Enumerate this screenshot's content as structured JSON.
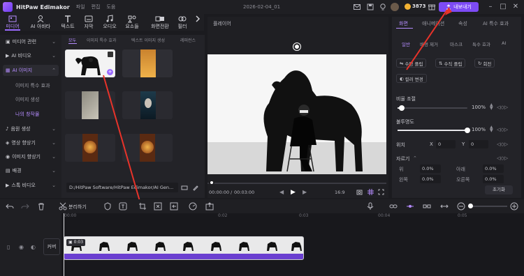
{
  "titlebar": {
    "app_name": "HitPaw Edimakor",
    "menu": [
      "파일",
      "편집",
      "도움"
    ],
    "doc_title": "2026-02-04_01",
    "credits": "3873",
    "export_label": "내보내기"
  },
  "tool_tabs": [
    {
      "label": "미디어",
      "icon": "media-icon"
    },
    {
      "label": "AI 아바타",
      "icon": "avatar-icon"
    },
    {
      "label": "텍스트",
      "icon": "text-icon"
    },
    {
      "label": "자막",
      "icon": "subtitle-icon"
    },
    {
      "label": "오디오",
      "icon": "audio-icon"
    },
    {
      "label": "요소들",
      "icon": "elements-icon"
    },
    {
      "label": "화면전환",
      "icon": "transition-icon"
    },
    {
      "label": "필터",
      "icon": "filter-icon"
    }
  ],
  "sidebar": {
    "items": [
      {
        "label": "미디어 관련",
        "icon": "folder-icon"
      },
      {
        "label": "AI 비디오",
        "icon": "ai-video-icon"
      },
      {
        "label": "AI 이미지",
        "icon": "ai-image-icon"
      }
    ],
    "subitems": [
      "이미지 특수 효과",
      "이미지 생성",
      "나의 창작물"
    ],
    "lower_items": [
      {
        "label": "음원 생성",
        "icon": "music-icon"
      },
      {
        "label": "영상 향상기",
        "icon": "enhance-icon"
      },
      {
        "label": "이미지 향상기",
        "icon": "image-enhance-icon"
      },
      {
        "label": "배경",
        "icon": "background-icon"
      },
      {
        "label": "스톡 비디오",
        "icon": "stock-icon"
      }
    ]
  },
  "media": {
    "subtabs": [
      "모두",
      "이미지 특수 효과",
      "텍스트 이미지 생성",
      "레퍼런스"
    ],
    "path": "D:/HitPaw Software/HitPaw Edimakor/AI Gen..."
  },
  "player": {
    "title": "플레이어",
    "current_time": "00:00:00",
    "total_time": "00:03:00",
    "ratio": "16:9"
  },
  "props": {
    "tabs": [
      "화면",
      "애니메이션",
      "속성",
      "AI 특수 효과"
    ],
    "subtabs": [
      "일반",
      "배경 제거",
      "마스크",
      "특수 효과",
      "AI"
    ],
    "buttons": [
      "수평 플립",
      "수직 플립",
      "회전",
      "컬러 변경"
    ],
    "scale_label": "비율 조절",
    "scale_value": "100%",
    "scale_fraction": 0.06,
    "opacity_label": "불투명도",
    "opacity_value": "100%",
    "opacity_fraction": 1.0,
    "position_label": "위치",
    "x_label": "X",
    "x_value": "0",
    "y_label": "Y",
    "y_value": "0",
    "crop_label": "자르기",
    "crop_fields": [
      {
        "label": "위",
        "value": "0.0%"
      },
      {
        "label": "아래",
        "value": "0.0%"
      },
      {
        "label": "왼쪽",
        "value": "0.0%"
      },
      {
        "label": "오른쪽",
        "value": "0.0%"
      }
    ],
    "reset_label": "초기화"
  },
  "timeline": {
    "split_label": "분리하기",
    "ticks": [
      "00:00",
      "0:02",
      "0:03",
      "00:04",
      "0:05"
    ],
    "track_label": "커버",
    "clip_duration": "0:03"
  }
}
